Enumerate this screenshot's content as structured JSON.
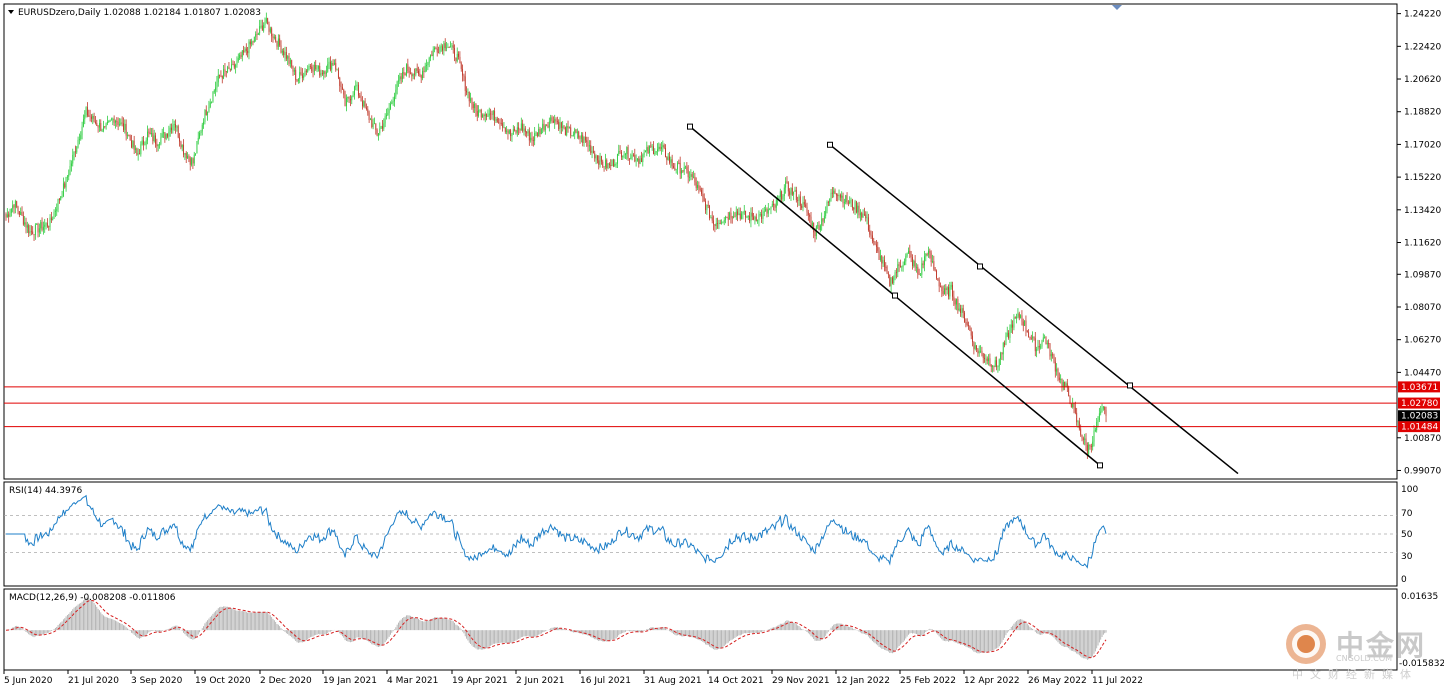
{
  "header": {
    "symbol_line": "EURUSDzero,Daily  1.02088 1.02184 1.01807 1.02083"
  },
  "rsi": {
    "label": "RSI(14) 44.3976",
    "levels": [
      "100",
      "70",
      "50",
      "30",
      "0"
    ]
  },
  "macd": {
    "label": "MACD(12,26,9) -0.008208 -0.011806",
    "scale_top": "0.01635",
    "scale_bottom": "-0.015832"
  },
  "price_axis": {
    "ticks": [
      "1.24220",
      "1.22420",
      "1.20620",
      "1.18820",
      "1.17020",
      "1.15220",
      "1.13420",
      "1.11620",
      "1.09870",
      "1.08070",
      "1.06270",
      "1.04470",
      "1.00870",
      "0.99070"
    ],
    "ylim": [
      0.986,
      1.2475
    ]
  },
  "hlines": [
    {
      "value": 1.03671,
      "label": "1.03671"
    },
    {
      "value": 1.0278,
      "label": "1.02780"
    },
    {
      "value": 1.01484,
      "label": "1.01484"
    }
  ],
  "current_price": {
    "value": 1.02083,
    "label": "1.02083"
  },
  "date_axis": [
    "5 Jun 2020",
    "21 Jul 2020",
    "3 Sep 2020",
    "19 Oct 2020",
    "2 Dec 2020",
    "19 Jan 2021",
    "4 Mar 2021",
    "19 Apr 2021",
    "2 Jun 2021",
    "16 Jul 2021",
    "31 Aug 2021",
    "14 Oct 2021",
    "29 Nov 2021",
    "12 Jan 2022",
    "25 Feb 2022",
    "12 Apr 2022",
    "26 May 2022",
    "11 Jul 2022"
  ],
  "colors": {
    "bull": "#2ecc40",
    "bear": "#c0392b",
    "rsi_line": "#1e7fc8",
    "macd_signal": "#d62020",
    "hline": "#e00000",
    "channel": "#000000"
  },
  "watermark": {
    "brand": "中金网",
    "url": "CNGOLD.COM",
    "sub": "中文财经新媒体"
  },
  "chart_data": {
    "type": "candlestick",
    "title": "EURUSDzero,Daily",
    "anchors": [
      [
        0,
        1.13
      ],
      [
        6,
        1.138
      ],
      [
        18,
        1.122
      ],
      [
        33,
        1.127
      ],
      [
        45,
        1.15
      ],
      [
        52,
        1.168
      ],
      [
        60,
        1.188
      ],
      [
        66,
        1.183
      ],
      [
        74,
        1.178
      ],
      [
        81,
        1.185
      ],
      [
        90,
        1.178
      ],
      [
        98,
        1.164
      ],
      [
        106,
        1.176
      ],
      [
        113,
        1.172
      ],
      [
        120,
        1.176
      ],
      [
        126,
        1.183
      ],
      [
        133,
        1.167
      ],
      [
        140,
        1.16
      ],
      [
        148,
        1.185
      ],
      [
        160,
        1.208
      ],
      [
        170,
        1.212
      ],
      [
        178,
        1.22
      ],
      [
        186,
        1.228
      ],
      [
        194,
        1.238
      ],
      [
        202,
        1.228
      ],
      [
        210,
        1.219
      ],
      [
        218,
        1.206
      ],
      [
        228,
        1.214
      ],
      [
        236,
        1.21
      ],
      [
        246,
        1.216
      ],
      [
        254,
        1.192
      ],
      [
        262,
        1.202
      ],
      [
        270,
        1.188
      ],
      [
        278,
        1.176
      ],
      [
        285,
        1.185
      ],
      [
        292,
        1.201
      ],
      [
        300,
        1.212
      ],
      [
        310,
        1.208
      ],
      [
        320,
        1.222
      ],
      [
        330,
        1.226
      ],
      [
        338,
        1.218
      ],
      [
        345,
        1.2
      ],
      [
        352,
        1.188
      ],
      [
        360,
        1.188
      ],
      [
        370,
        1.184
      ],
      [
        378,
        1.175
      ],
      [
        386,
        1.18
      ],
      [
        394,
        1.173
      ],
      [
        402,
        1.18
      ],
      [
        410,
        1.185
      ],
      [
        418,
        1.178
      ],
      [
        426,
        1.176
      ],
      [
        434,
        1.172
      ],
      [
        441,
        1.165
      ],
      [
        446,
        1.16
      ],
      [
        452,
        1.158
      ],
      [
        462,
        1.167
      ],
      [
        474,
        1.162
      ],
      [
        483,
        1.168
      ],
      [
        492,
        1.167
      ],
      [
        500,
        1.158
      ],
      [
        506,
        1.157
      ],
      [
        514,
        1.152
      ],
      [
        522,
        1.14
      ],
      [
        530,
        1.127
      ],
      [
        538,
        1.13
      ],
      [
        546,
        1.133
      ],
      [
        556,
        1.13
      ],
      [
        566,
        1.131
      ],
      [
        576,
        1.136
      ],
      [
        584,
        1.147
      ],
      [
        592,
        1.142
      ],
      [
        600,
        1.133
      ],
      [
        606,
        1.122
      ],
      [
        612,
        1.13
      ],
      [
        620,
        1.146
      ],
      [
        628,
        1.14
      ],
      [
        636,
        1.136
      ],
      [
        644,
        1.13
      ],
      [
        650,
        1.115
      ],
      [
        656,
        1.106
      ],
      [
        662,
        1.094
      ],
      [
        668,
        1.102
      ],
      [
        676,
        1.11
      ],
      [
        684,
        1.098
      ],
      [
        690,
        1.112
      ],
      [
        696,
        1.1
      ],
      [
        702,
        1.088
      ],
      [
        708,
        1.09
      ],
      [
        714,
        1.08
      ],
      [
        720,
        1.072
      ],
      [
        726,
        1.058
      ],
      [
        734,
        1.053
      ],
      [
        742,
        1.048
      ],
      [
        748,
        1.06
      ],
      [
        754,
        1.072
      ],
      [
        760,
        1.076
      ],
      [
        766,
        1.066
      ],
      [
        772,
        1.058
      ],
      [
        778,
        1.064
      ],
      [
        784,
        1.052
      ],
      [
        790,
        1.04
      ],
      [
        794,
        1.036
      ],
      [
        798,
        1.028
      ],
      [
        802,
        1.018
      ],
      [
        806,
        1.01
      ],
      [
        810,
        1.002
      ],
      [
        814,
        1.008
      ],
      [
        818,
        1.018
      ],
      [
        822,
        1.024
      ],
      [
        824,
        1.0208
      ]
    ],
    "rsi_ylim": [
      0,
      100
    ],
    "rsi_levels": [
      70,
      50,
      30
    ],
    "macd_ylim": [
      -0.015832,
      0.01635
    ],
    "channels": [
      {
        "from": [
          1.18,
          1.0945
        ],
        "to": [
          0.9935,
          0.9895
        ]
      },
      {
        "from": [
          1.17,
          1.0975
        ],
        "to": [
          1.0375,
          0.991
        ]
      }
    ]
  }
}
